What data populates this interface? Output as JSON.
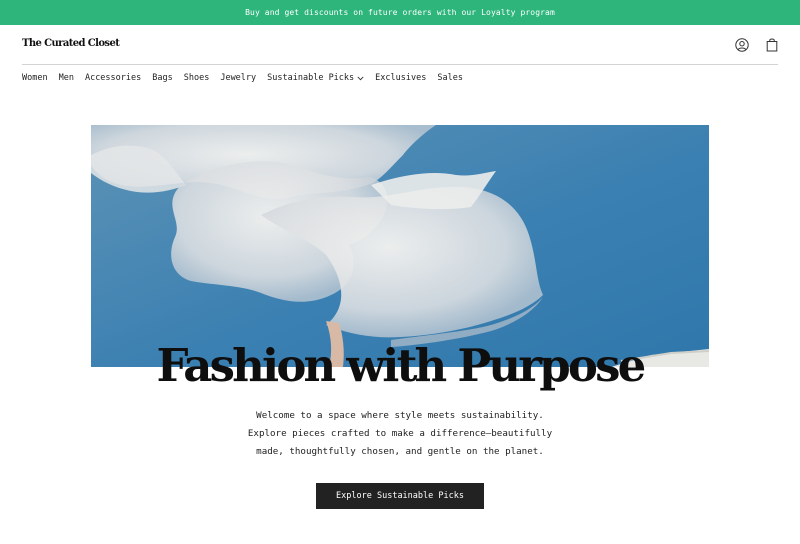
{
  "announcement": {
    "text": "Buy and get discounts on future orders with our Loyalty program"
  },
  "header": {
    "logo": "The Curated Closet",
    "icons": [
      "account-icon",
      "shopping-bag-icon"
    ]
  },
  "nav": {
    "items": [
      {
        "label": "Women"
      },
      {
        "label": "Men"
      },
      {
        "label": "Accessories"
      },
      {
        "label": "Bags"
      },
      {
        "label": "Shoes"
      },
      {
        "label": "Jewelry"
      },
      {
        "label": "Sustainable Picks",
        "has_dropdown": true
      },
      {
        "label": "Exclusives"
      },
      {
        "label": "Sales"
      }
    ]
  },
  "hero": {
    "image": "sheer-white-fabric-against-blue-sky",
    "headline": "Fashion with Purpose",
    "subtext": [
      "Welcome to a space where style meets sustainability.",
      "Explore pieces crafted to make a difference—beautifully",
      "made, thoughtfully chosen, and gentle on the planet."
    ],
    "cta_label": "Explore Sustainable Picks"
  },
  "colors": {
    "announcement_bg": "#2db57b",
    "button_bg": "#222222",
    "sky": "#3a7fb0"
  }
}
